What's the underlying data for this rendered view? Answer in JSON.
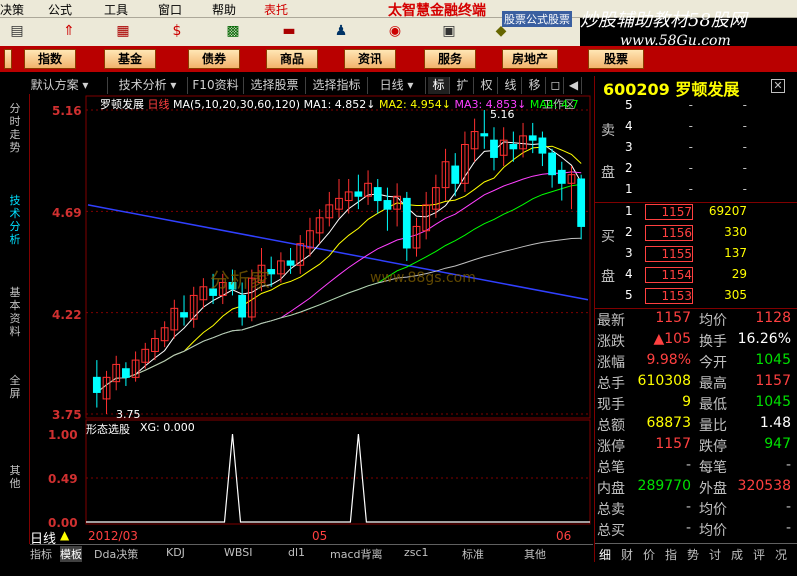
{
  "menu": {
    "items": [
      "决策",
      "公式",
      "工具",
      "窗口",
      "帮助"
    ],
    "highlight": "表托"
  },
  "brand": "太智慧金融终端",
  "tip": "股票公式股票",
  "watermark": {
    "title": "炒股辅助教材58股网",
    "url": "www.58Gu.com"
  },
  "buttons": [
    "指数",
    "基金",
    "债券",
    "商品",
    "资讯",
    "服务",
    "房地产",
    "股票"
  ],
  "toolbar": {
    "items": [
      "默认方案",
      "技术分析",
      "F10资料",
      "选择股票",
      "选择指标",
      "日线",
      "标",
      "扩",
      "权",
      "线",
      "移"
    ],
    "right_label": "工作区"
  },
  "lefttabs": [
    "分时走势",
    "技术分析",
    "基本资料",
    "全屏",
    "其他"
  ],
  "stock": {
    "code": "600209",
    "name": "罗顿发展",
    "period": "日线"
  },
  "ma_legend": {
    "spec": "MA(5,10,20,30,60,120)",
    "ma1": "MA1: 4.852↓",
    "ma2": "MA2: 4.954↓",
    "ma3": "MA3: 4.853↓",
    "ma4": "MA4: 4.7"
  },
  "chart_watermark": {
    "text": "分析家",
    "url": "www.88gs.com"
  },
  "chart_data": {
    "type": "candlestick",
    "yticks": [
      "5.16",
      "4.69",
      "4.22",
      "3.75"
    ],
    "ylim": [
      3.75,
      5.16
    ],
    "annotations": {
      "high": "5.16",
      "low": "3.75"
    },
    "candles": [
      [
        3.92,
        3.85,
        4.0,
        3.78
      ],
      [
        3.82,
        3.92,
        3.95,
        3.75
      ],
      [
        3.9,
        3.98,
        4.02,
        3.86
      ],
      [
        3.96,
        3.92,
        3.99,
        3.88
      ],
      [
        3.92,
        4.0,
        4.04,
        3.9
      ],
      [
        3.99,
        4.05,
        4.08,
        3.96
      ],
      [
        4.04,
        4.1,
        4.14,
        4.0
      ],
      [
        4.09,
        4.15,
        4.18,
        4.06
      ],
      [
        4.14,
        4.24,
        4.28,
        4.1
      ],
      [
        4.22,
        4.2,
        4.3,
        4.16
      ],
      [
        4.19,
        4.3,
        4.34,
        4.15
      ],
      [
        4.28,
        4.34,
        4.38,
        4.24
      ],
      [
        4.33,
        4.3,
        4.4,
        4.26
      ],
      [
        4.3,
        4.36,
        4.4,
        4.26
      ],
      [
        4.36,
        4.33,
        4.42,
        4.3
      ],
      [
        4.3,
        4.2,
        4.36,
        4.16
      ],
      [
        4.2,
        4.38,
        4.42,
        4.18
      ],
      [
        4.36,
        4.44,
        4.52,
        4.32
      ],
      [
        4.42,
        4.4,
        4.48,
        4.34
      ],
      [
        4.4,
        4.46,
        4.5,
        4.36
      ],
      [
        4.46,
        4.44,
        4.52,
        4.4
      ],
      [
        4.44,
        4.54,
        4.58,
        4.4
      ],
      [
        4.52,
        4.6,
        4.66,
        4.48
      ],
      [
        4.59,
        4.66,
        4.7,
        4.54
      ],
      [
        4.66,
        4.72,
        4.78,
        4.62
      ],
      [
        4.7,
        4.75,
        4.84,
        4.66
      ],
      [
        4.74,
        4.78,
        4.84,
        4.68
      ],
      [
        4.78,
        4.76,
        4.86,
        4.7
      ],
      [
        4.76,
        4.82,
        4.88,
        4.72
      ],
      [
        4.8,
        4.74,
        4.84,
        4.68
      ],
      [
        4.74,
        4.7,
        4.8,
        4.6
      ],
      [
        4.7,
        4.76,
        4.82,
        4.62
      ],
      [
        4.75,
        4.52,
        4.78,
        4.46
      ],
      [
        4.52,
        4.62,
        4.66,
        4.48
      ],
      [
        4.6,
        4.72,
        4.78,
        4.56
      ],
      [
        4.7,
        4.8,
        4.86,
        4.66
      ],
      [
        4.8,
        4.92,
        4.98,
        4.74
      ],
      [
        4.9,
        4.82,
        4.96,
        4.76
      ],
      [
        4.82,
        5.0,
        5.06,
        4.78
      ],
      [
        4.98,
        5.06,
        5.12,
        4.92
      ],
      [
        5.05,
        5.04,
        5.16,
        4.98
      ],
      [
        5.02,
        4.94,
        5.08,
        4.88
      ],
      [
        4.95,
        5.02,
        5.08,
        4.9
      ],
      [
        5.0,
        4.98,
        5.06,
        4.92
      ],
      [
        4.98,
        5.04,
        5.1,
        4.94
      ],
      [
        5.04,
        5.02,
        5.1,
        4.96
      ],
      [
        5.03,
        4.96,
        5.06,
        4.9
      ],
      [
        4.96,
        4.86,
        4.98,
        4.8
      ],
      [
        4.88,
        4.82,
        4.92,
        4.74
      ],
      [
        4.82,
        4.86,
        4.9,
        4.7
      ],
      [
        4.84,
        4.62,
        4.86,
        4.56
      ]
    ]
  },
  "indicator": {
    "title": "形态选股",
    "xg": "XG: 0.000",
    "yticks": [
      "1.00",
      "0.49",
      "0.00"
    ],
    "spikes": [
      14,
      27
    ]
  },
  "dates": {
    "label": "日线",
    "d1": "2012/03",
    "d2": "05",
    "d3": "06"
  },
  "bottomtabs": [
    "指标",
    "模板",
    "Dda决策",
    "KDJ",
    "WBSI",
    "dl1",
    "macd背离",
    "zsc1",
    "标准",
    "其他"
  ],
  "orderbook": {
    "sell": [
      {
        "idx": "5",
        "price": "-",
        "vol": "-"
      },
      {
        "idx": "4",
        "price": "-",
        "vol": "-"
      },
      {
        "idx": "3",
        "price": "-",
        "vol": "-"
      },
      {
        "idx": "2",
        "price": "-",
        "vol": "-"
      },
      {
        "idx": "1",
        "price": "-",
        "vol": "-"
      }
    ],
    "buy": [
      {
        "idx": "1",
        "price": "1157",
        "vol": "69207"
      },
      {
        "idx": "2",
        "price": "1156",
        "vol": "330"
      },
      {
        "idx": "3",
        "price": "1155",
        "vol": "137"
      },
      {
        "idx": "4",
        "price": "1154",
        "vol": "29"
      },
      {
        "idx": "5",
        "price": "1153",
        "vol": "305"
      }
    ],
    "sell_label": [
      "卖",
      "盘"
    ],
    "buy_label": [
      "买",
      "盘"
    ]
  },
  "stats": [
    {
      "l1": "最新",
      "v1": "1157",
      "c1": "red",
      "l2": "均价",
      "v2": "1128",
      "c2": "red"
    },
    {
      "l1": "涨跌",
      "v1": "▲105",
      "c1": "red",
      "l2": "换手",
      "v2": "16.26%",
      "c2": "wht"
    },
    {
      "l1": "涨幅",
      "v1": "9.98%",
      "c1": "red",
      "l2": "今开",
      "v2": "1045",
      "c2": "grn"
    },
    {
      "l1": "总手",
      "v1": "610308",
      "c1": "yel",
      "l2": "最高",
      "v2": "1157",
      "c2": "red"
    },
    {
      "l1": "现手",
      "v1": "9",
      "c1": "yel",
      "l2": "最低",
      "v2": "1045",
      "c2": "grn"
    },
    {
      "l1": "总额",
      "v1": "68873",
      "c1": "yel",
      "l2": "量比",
      "v2": "1.48",
      "c2": "wht"
    },
    {
      "l1": "涨停",
      "v1": "1157",
      "c1": "red",
      "l2": "跌停",
      "v2": "947",
      "c2": "grn"
    },
    {
      "l1": "总笔",
      "v1": "-",
      "c1": "dash",
      "l2": "每笔",
      "v2": "-",
      "c2": "dash"
    },
    {
      "l1": "内盘",
      "v1": "289770",
      "c1": "grn",
      "l2": "外盘",
      "v2": "320538",
      "c2": "red"
    },
    {
      "l1": "总卖",
      "v1": "-",
      "c1": "dash",
      "l2": "均价",
      "v2": "-",
      "c2": "dash"
    },
    {
      "l1": "总买",
      "v1": "-",
      "c1": "dash",
      "l2": "均价",
      "v2": "-",
      "c2": "dash"
    }
  ],
  "righttabs": [
    "细",
    "财",
    "价",
    "指",
    "势",
    "讨",
    "成",
    "评",
    "况"
  ],
  "colors": {
    "up": "#ff3030",
    "down": "#00ffff",
    "grid": "#800000"
  }
}
